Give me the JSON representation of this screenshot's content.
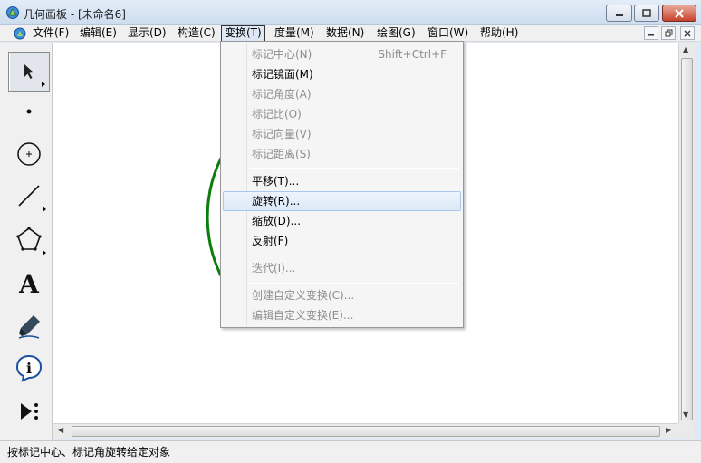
{
  "window": {
    "title": "几何画板 - [未命名6]"
  },
  "menubar": {
    "items": [
      {
        "label": "文件(F)"
      },
      {
        "label": "编辑(E)"
      },
      {
        "label": "显示(D)"
      },
      {
        "label": "构造(C)"
      },
      {
        "label": "变换(T)"
      },
      {
        "label": "度量(M)"
      },
      {
        "label": "数据(N)"
      },
      {
        "label": "绘图(G)"
      },
      {
        "label": "窗口(W)"
      },
      {
        "label": "帮助(H)"
      }
    ]
  },
  "transform_menu": {
    "items": [
      {
        "label": "标记中心(N)",
        "shortcut": "Shift+Ctrl+F"
      },
      {
        "label": "标记镜面(M)"
      },
      {
        "label": "标记角度(A)"
      },
      {
        "label": "标记比(O)"
      },
      {
        "label": "标记向量(V)"
      },
      {
        "label": "标记距离(S)"
      },
      {
        "label": "平移(T)..."
      },
      {
        "label": "旋转(R)..."
      },
      {
        "label": "缩放(D)..."
      },
      {
        "label": "反射(F)"
      },
      {
        "label": "迭代(I)..."
      },
      {
        "label": "创建自定义变换(C)..."
      },
      {
        "label": "编辑自定义变换(E)..."
      }
    ]
  },
  "toolbox": {
    "text_tool_glyph": "A",
    "info_tool_glyph": "i"
  },
  "colors": {
    "circle": "#0b7d0b",
    "accent": "#1a4f9c"
  },
  "statusbar": {
    "text": "按标记中心、标记角旋转给定对象"
  }
}
